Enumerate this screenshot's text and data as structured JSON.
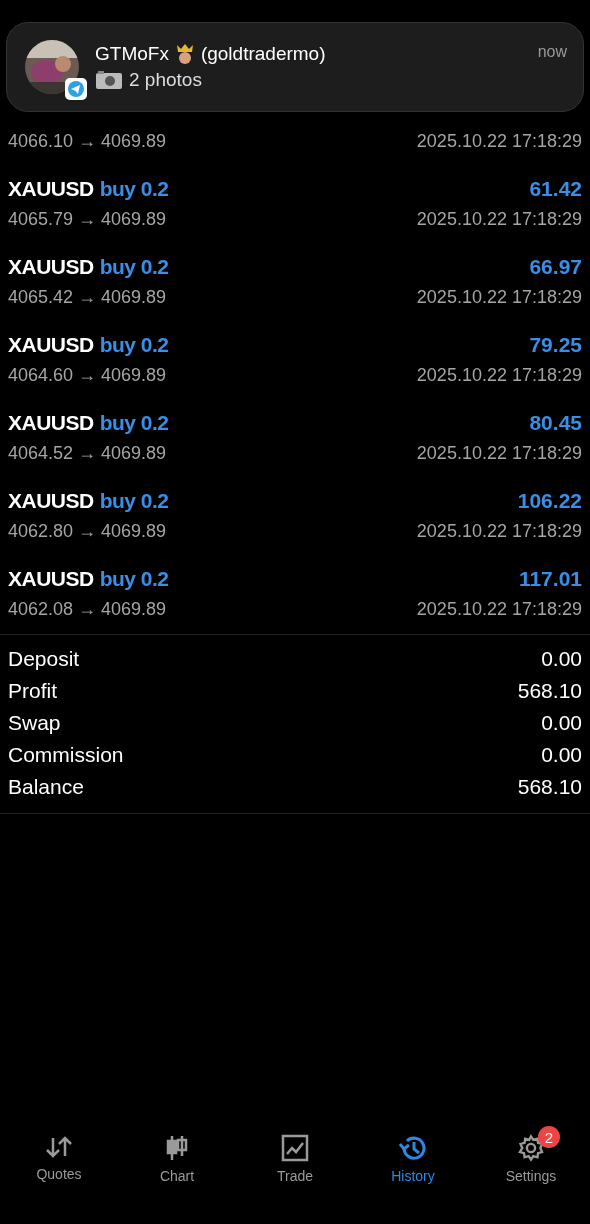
{
  "notification": {
    "sender": "GTMoFx",
    "handle": "(goldtradermo)",
    "message": "2 photos",
    "time": "now"
  },
  "deals": [
    {
      "prices": "4066.10 → 4069.89",
      "time": "2025.10.22 17:18:29"
    },
    {
      "symbol": "XAUUSD",
      "side": "buy 0.2",
      "profit": "61.42",
      "prices": "4065.79 → 4069.89",
      "time": "2025.10.22 17:18:29"
    },
    {
      "symbol": "XAUUSD",
      "side": "buy 0.2",
      "profit": "66.97",
      "prices": "4065.42 → 4069.89",
      "time": "2025.10.22 17:18:29"
    },
    {
      "symbol": "XAUUSD",
      "side": "buy 0.2",
      "profit": "79.25",
      "prices": "4064.60 → 4069.89",
      "time": "2025.10.22 17:18:29"
    },
    {
      "symbol": "XAUUSD",
      "side": "buy 0.2",
      "profit": "80.45",
      "prices": "4064.52 → 4069.89",
      "time": "2025.10.22 17:18:29"
    },
    {
      "symbol": "XAUUSD",
      "side": "buy 0.2",
      "profit": "106.22",
      "prices": "4062.80 → 4069.89",
      "time": "2025.10.22 17:18:29"
    },
    {
      "symbol": "XAUUSD",
      "side": "buy 0.2",
      "profit": "117.01",
      "prices": "4062.08 → 4069.89",
      "time": "2025.10.22 17:18:29"
    }
  ],
  "summary": [
    {
      "label": "Deposit",
      "value": "0.00"
    },
    {
      "label": "Profit",
      "value": "568.10"
    },
    {
      "label": "Swap",
      "value": "0.00"
    },
    {
      "label": "Commission",
      "value": "0.00"
    },
    {
      "label": "Balance",
      "value": "568.10"
    }
  ],
  "tab_bar": [
    {
      "kind": "quotes",
      "label": "Quotes",
      "selected": false
    },
    {
      "kind": "chart",
      "label": "Chart",
      "selected": false
    },
    {
      "kind": "trade",
      "label": "Trade",
      "selected": false
    },
    {
      "kind": "history",
      "label": "History",
      "selected": true
    },
    {
      "kind": "settings",
      "label": "Settings",
      "selected": false,
      "badge": "2"
    }
  ]
}
